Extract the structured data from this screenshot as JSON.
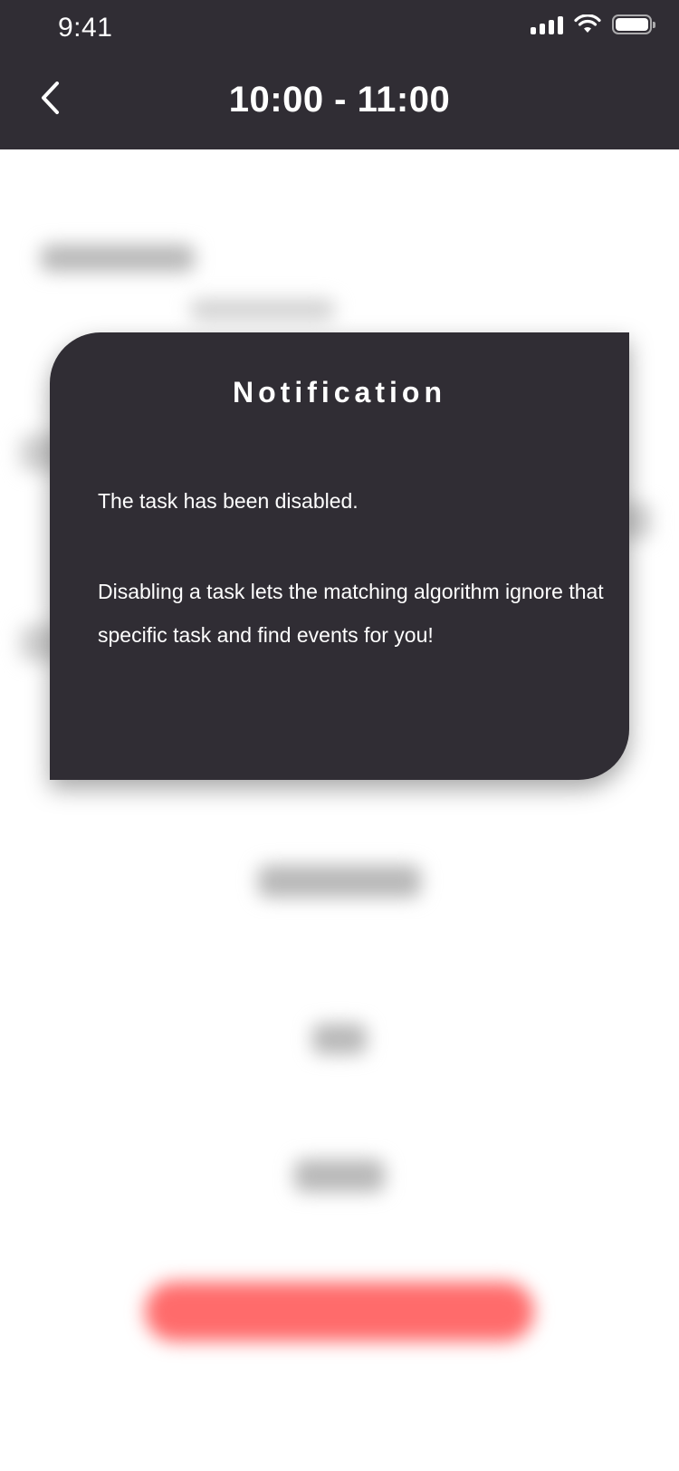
{
  "status_bar": {
    "time": "9:41",
    "icons": [
      "signal-icon",
      "wifi-icon",
      "battery-icon"
    ]
  },
  "header": {
    "title": "10:00 - 11:00",
    "back_icon": "chevron-left-icon"
  },
  "modal": {
    "title": "Notification",
    "message": "The task has been disabled.",
    "detail": "Disabling a task lets the matching algorithm ignore that specific task and find events for you!"
  },
  "colors": {
    "header_bg": "#302d34",
    "modal_bg": "#302d34",
    "accent_red": "#ff6b6b"
  }
}
